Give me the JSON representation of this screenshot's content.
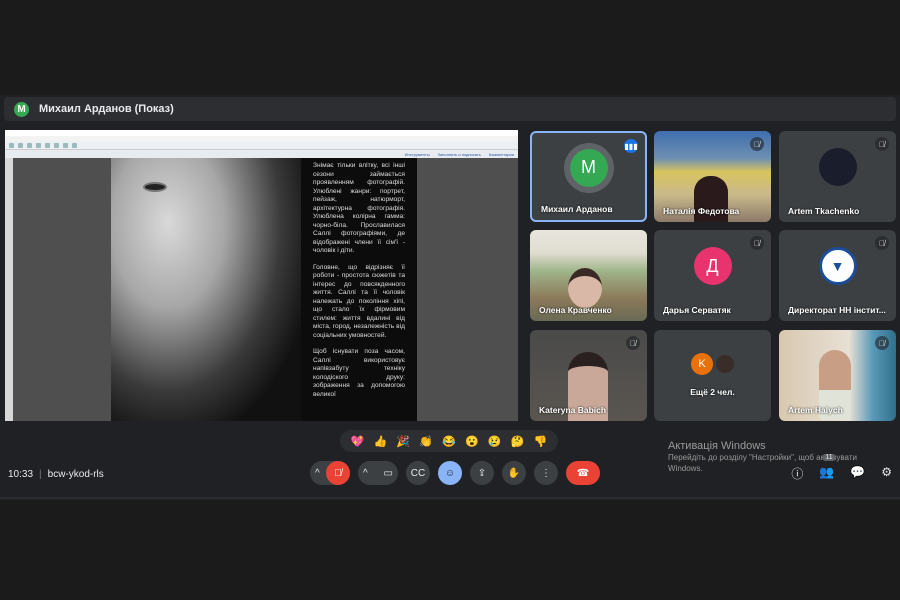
{
  "header": {
    "avatar_letter": "M",
    "title": "Михаил Арданов (Показ)"
  },
  "presentation": {
    "paragraphs": [
      "Знімає тільки влітку, всі інші сезони займається проявленням фотографій. Улюблені жанри: портрет, пейзаж, натюрморт, архітектурна фотографія. Улюблена колірна гамма: чорно-біла. Прославилася Саллі фотографіями, де відображені члени її сім'ї - чоловік і діти.",
      "Головне, що відрізняє її роботи - простота сюжетів та інтерес до повсякденного життя. Саллі та її чоловік належать до покоління хіпі, що стало їх фірмовим стилем: життя вдалині від міста, город, незалежність від соціальних умовностей.",
      "Щоб існувати поза часом, Саллі використовує напівзабуту техніку колодіского друку: зображення за допомогою великої"
    ],
    "toolbar_right": [
      "Инструменты",
      "Заполнить и подписать",
      "Комментарии"
    ]
  },
  "participants": [
    {
      "name": "Михаил Арданов",
      "avatar": "M",
      "color": "#34a853",
      "speaking": true
    },
    {
      "name": "Наталія Федотова",
      "muted": true
    },
    {
      "name": "Artem Tkachenko",
      "muted": true
    },
    {
      "name": "Олена Кравченко"
    },
    {
      "name": "Дарья Серватяк",
      "avatar": "Д",
      "color": "#e8336f",
      "muted": true
    },
    {
      "name": "Директорат НН інстит...",
      "muted": true
    },
    {
      "name": "Kateryna Babich",
      "muted": true
    },
    {
      "name": "Ещё 2 чел.",
      "avatar": "K",
      "color": "#e8710a"
    },
    {
      "name": "Artem Halych",
      "muted": true
    }
  ],
  "reactions": [
    "💖",
    "👍",
    "🎉",
    "👏",
    "😂",
    "😮",
    "😢",
    "🤔",
    "👎"
  ],
  "footer": {
    "time": "10:33",
    "separator": "|",
    "code": "bcw-ykod-rls",
    "people_count": "11"
  },
  "watermark": {
    "title": "Активація Windows",
    "line1": "Перейдіть до розділу \"Настройки\", щоб активувати",
    "line2": "Windows."
  }
}
